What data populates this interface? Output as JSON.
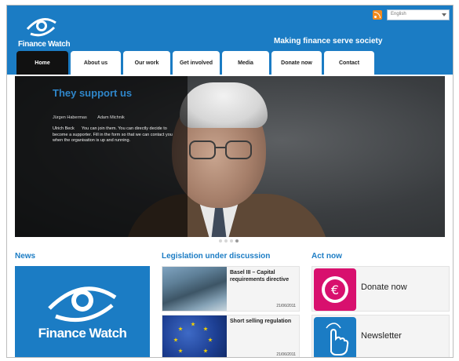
{
  "header": {
    "logo_text": "Finance Watch",
    "tagline": "Making finance serve society",
    "language_select": "English",
    "accent": "#1b7cc4"
  },
  "nav": {
    "tabs": [
      {
        "label": "Home",
        "active": true
      },
      {
        "label": "About us",
        "active": false
      },
      {
        "label": "Our work",
        "active": false
      },
      {
        "label": "Get involved",
        "active": false
      },
      {
        "label": "Media",
        "active": false
      },
      {
        "label": "Donate now",
        "active": false
      },
      {
        "label": "Contact",
        "active": false
      }
    ]
  },
  "hero": {
    "title": "They support us",
    "names_left": "Jürgen Habermas",
    "names_right": "Adam Michnik",
    "names_left2": "Ulrich Beck",
    "body": "You can join them. You can directly decide to become a supporter. Fill in the form so that we can contact you when the organisation is up and running."
  },
  "news": {
    "heading": "News",
    "logo_text": "Finance Watch"
  },
  "legislation": {
    "heading": "Legislation under discussion",
    "items": [
      {
        "title": "Basel III – Capital requirements directive",
        "date": "21/06/2011"
      },
      {
        "title": "Short selling regulation",
        "date": "21/06/2011"
      }
    ]
  },
  "act": {
    "heading": "Act now",
    "items": [
      {
        "label": "Donate now",
        "icon": "euro-icon",
        "color": "#d8106e"
      },
      {
        "label": "Newsletter",
        "icon": "hand-pointer-icon",
        "color": "#1b7cc4"
      }
    ]
  }
}
